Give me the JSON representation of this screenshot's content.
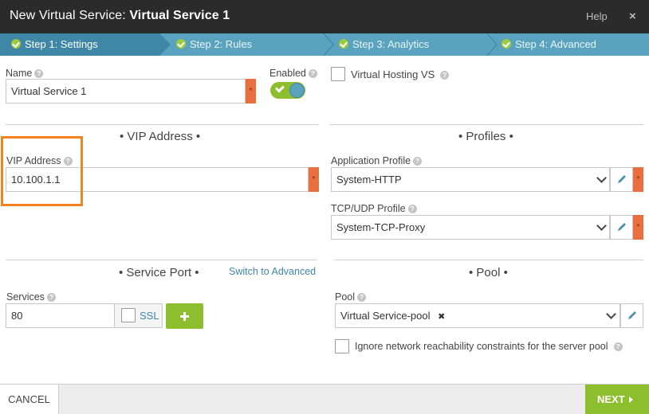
{
  "window": {
    "title_prefix": "New Virtual Service:",
    "title_name": "Virtual Service 1",
    "help_label": "Help",
    "close_glyph": "×"
  },
  "steps": [
    {
      "label": "Step 1: Settings",
      "active": true
    },
    {
      "label": "Step 2: Rules",
      "active": false
    },
    {
      "label": "Step 3: Analytics",
      "active": false
    },
    {
      "label": "Step 4: Advanced",
      "active": false
    }
  ],
  "settings": {
    "name_label": "Name",
    "name_value": "Virtual Service 1",
    "enabled_label": "Enabled",
    "enabled": true,
    "virtual_hosting_label": "Virtual Hosting VS",
    "virtual_hosting_checked": false
  },
  "vip": {
    "section_title": "• VIP Address •",
    "address_label": "VIP Address",
    "address_value": "10.100.1.1"
  },
  "profiles": {
    "section_title": "• Profiles •",
    "app_profile_label": "Application Profile",
    "app_profile_value": "System-HTTP",
    "tcp_profile_label": "TCP/UDP Profile",
    "tcp_profile_value": "System-TCP-Proxy"
  },
  "service_port": {
    "section_title": "• Service Port •",
    "switch_link": "Switch to Advanced",
    "services_label": "Services",
    "services_value": "80",
    "ssl_label": "SSL",
    "ssl_checked": false
  },
  "pool": {
    "section_title": "• Pool •",
    "pool_label": "Pool",
    "pool_value": "Virtual Service-pool",
    "remove_glyph": "✖",
    "ignore_label": "Ignore network reachability constraints for the server pool",
    "ignore_checked": false
  },
  "required_marker": "*",
  "help_glyph": "?",
  "footer": {
    "cancel_label": "CANCEL",
    "next_label": "NEXT"
  },
  "colors": {
    "titlebar": "#2b2b2b",
    "steps": "#5aa3bf",
    "accent_green": "#8dbe2e",
    "required": "#e9703e",
    "highlight": "#f58220",
    "link": "#3e87a6"
  }
}
